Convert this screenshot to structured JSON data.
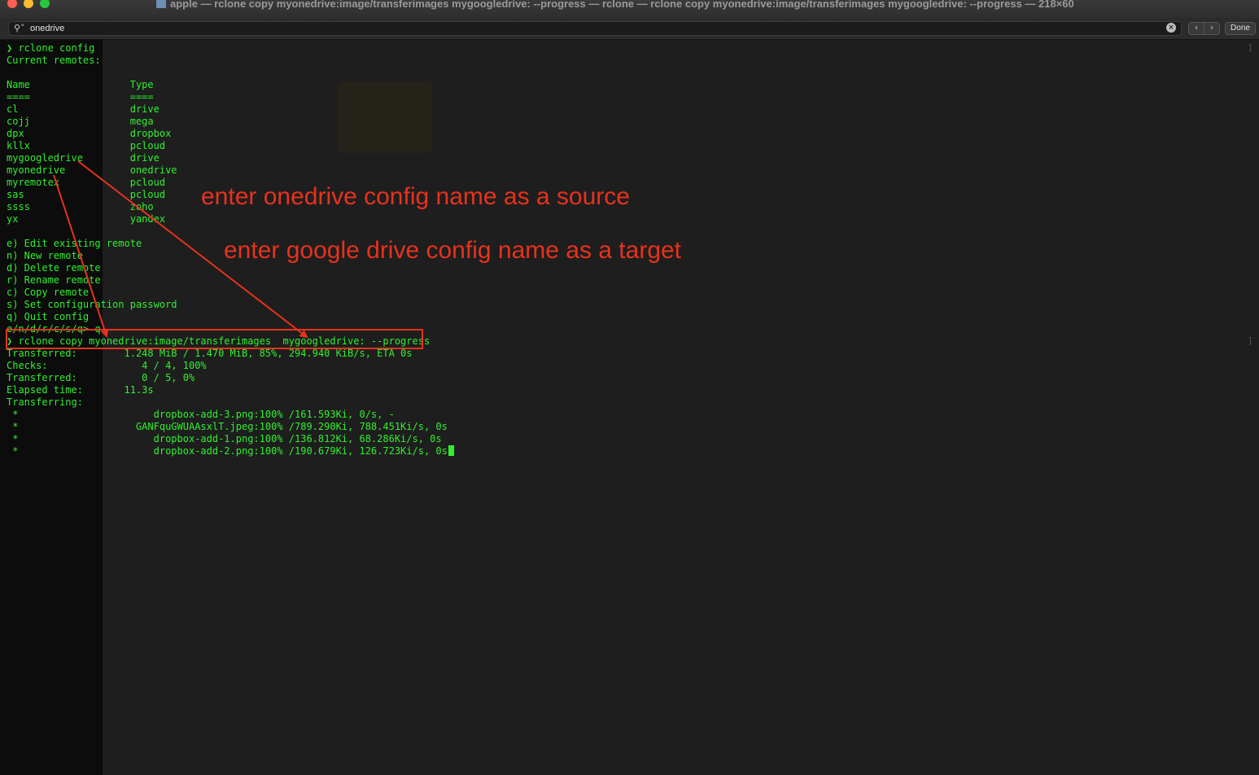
{
  "window": {
    "title": "apple — rclone copy myonedrive:image/transferimages mygoogledrive: --progress — rclone — rclone copy myonedrive:image/transferimages mygoogledrive: --progress — 218×60"
  },
  "find_bar": {
    "search_value": "onedrive",
    "prev_label": "‹",
    "next_label": "›",
    "done_label": "Done"
  },
  "terminal": {
    "lines": [
      "❯ rclone config",
      "Current remotes:",
      "",
      "Name                 Type",
      "====                 ====",
      "cl                   drive",
      "cojj                 mega",
      "dpx                  dropbox",
      "kllx                 pcloud",
      "mygoogledrive        drive",
      "myonedrive           onedrive",
      "myremotex            pcloud",
      "sas                  pcloud",
      "ssss                 zoho",
      "yx                   yandex",
      "",
      "e) Edit existing remote",
      "n) New remote",
      "d) Delete remote",
      "r) Rename remote",
      "c) Copy remote",
      "s) Set configuration password",
      "q) Quit config",
      "e/n/d/r/c/s/q> q",
      "❯ rclone copy myonedrive:image/transferimages  mygoogledrive: --progress",
      "Transferred:        1.248 MiB / 1.470 MiB, 85%, 294.940 KiB/s, ETA 0s",
      "Checks:                4 / 4, 100%",
      "Transferred:           0 / 5, 0%",
      "Elapsed time:       11.3s",
      "Transferring:",
      " *                       dropbox-add-3.png:100% /161.593Ki, 0/s, -",
      " *                    GANFquGWUAAsxlT.jpeg:100% /789.290Ki, 788.451Ki/s, 0s",
      " *                       dropbox-add-1.png:100% /136.812Ki, 68.286Ki/s, 0s",
      " *                       dropbox-add-2.png:100% /190.679Ki, 126.723Ki/s, 0s"
    ]
  },
  "annotations": {
    "source_note": "enter onedrive config name as a source",
    "target_note": "enter google drive config name as a target",
    "color": "#e8321c"
  },
  "colors": {
    "terminal_text": "#2ff02f",
    "terminal_bg": "#1e1e1e"
  }
}
